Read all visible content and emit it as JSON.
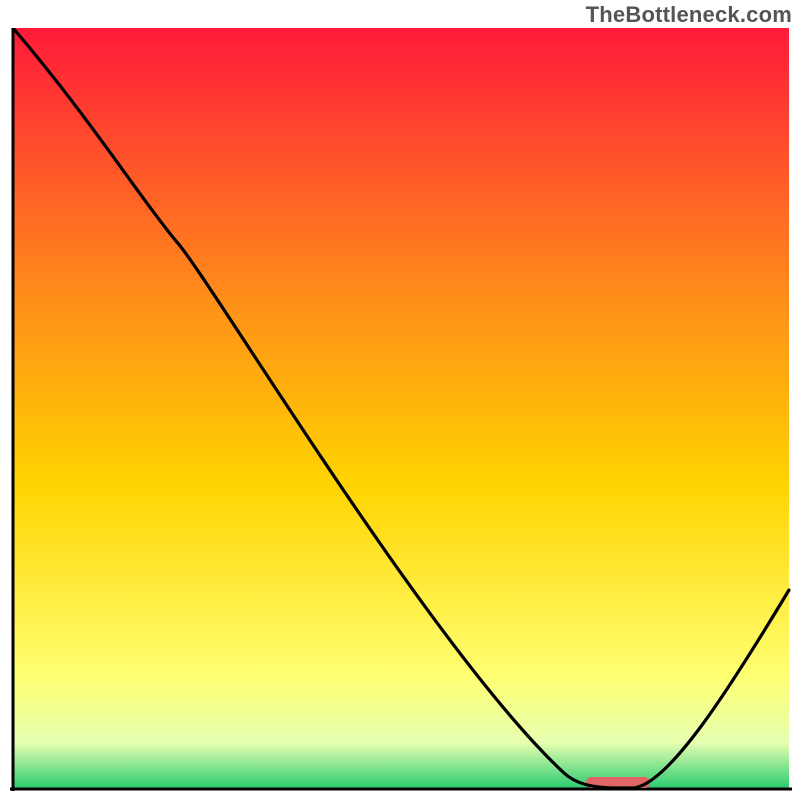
{
  "watermark": "TheBottleneck.com",
  "chart_data": {
    "type": "line",
    "title": "",
    "xlabel": "",
    "ylabel": "",
    "xlim": [
      0,
      100
    ],
    "ylim": [
      0,
      100
    ],
    "grid": false,
    "legend": false,
    "series": [
      {
        "name": "bottleneck-curve",
        "x": [
          0,
          21,
          71,
          78,
          80,
          100
        ],
        "values": [
          100,
          72,
          2,
          0,
          0,
          26
        ]
      }
    ],
    "marker": {
      "name": "highlight-range",
      "x_start": 74,
      "x_end": 82,
      "y": 0,
      "color": "#e06666"
    },
    "background_gradient": {
      "top_color": "#ff1a3a",
      "mid_color": "#ffd400",
      "low_color": "#ffff9e",
      "bottom_color": "#2ecc71"
    }
  }
}
